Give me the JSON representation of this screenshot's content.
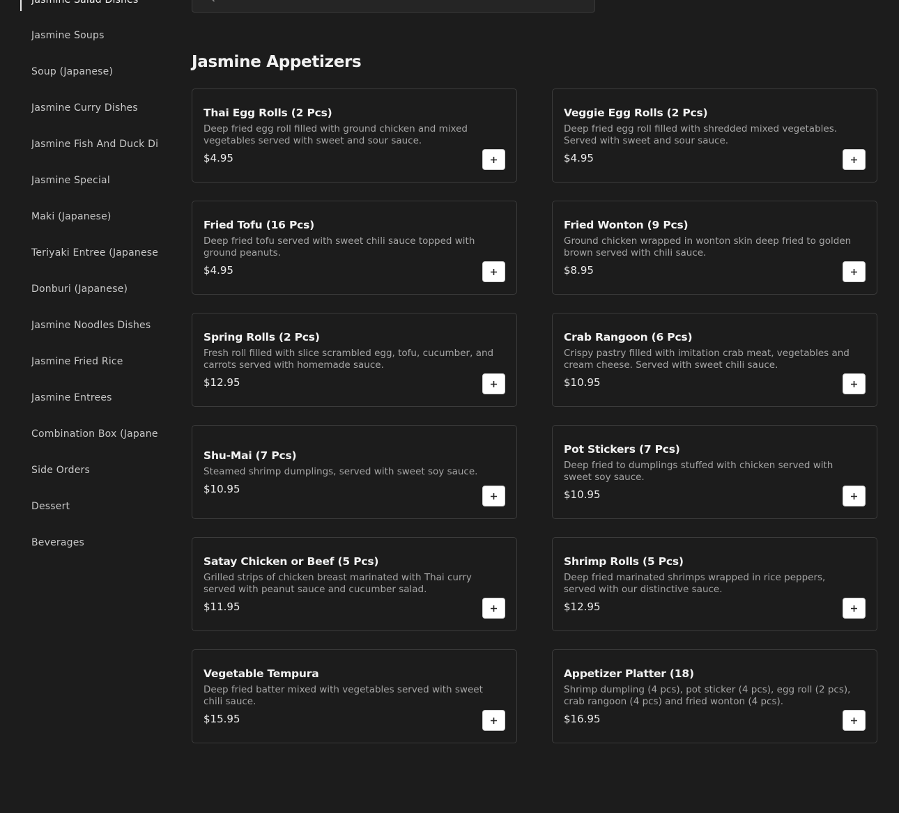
{
  "sidebar": {
    "active_item": "Jasmine Salad Dishes",
    "items": [
      "Jasmine Salad Dishes",
      "Jasmine Soups",
      "Soup (Japanese)",
      "Jasmine Curry Dishes",
      "Jasmine Fish And Duck Dishes",
      "Jasmine Special",
      "Maki (Japanese)",
      "Teriyaki Entree (Japanese)",
      "Donburi (Japanese)",
      "Jasmine Noodles Dishes",
      "Jasmine Fried Rice",
      "Jasmine Entrees",
      "Combination Box (Japanese)",
      "Side Orders",
      "Dessert",
      "Beverages"
    ]
  },
  "search": {
    "icon": "search-icon",
    "placeholder": ""
  },
  "section": {
    "title": "Jasmine Appetizers"
  },
  "items": [
    {
      "name": "Thai Egg Rolls (2 Pcs)",
      "description": "Deep fried egg roll filled with ground chicken and mixed vegetables served with sweet and sour sauce.",
      "price": "$4.95"
    },
    {
      "name": "Veggie Egg Rolls (2 Pcs)",
      "description": "Deep fried egg roll filled with shredded mixed vegetables. Served with sweet and sour sauce.",
      "price": "$4.95"
    },
    {
      "name": "Fried Tofu (16 Pcs)",
      "description": "Deep fried tofu served with sweet chili sauce topped with ground peanuts.",
      "price": "$4.95"
    },
    {
      "name": "Fried Wonton (9 Pcs)",
      "description": "Ground chicken wrapped in wonton skin deep fried to golden brown served with chili sauce.",
      "price": "$8.95"
    },
    {
      "name": "Spring Rolls (2 Pcs)",
      "description": "Fresh roll filled with slice scrambled egg, tofu, cucumber, and carrots served with homemade sauce.",
      "price": "$12.95"
    },
    {
      "name": "Crab Rangoon (6 Pcs)",
      "description": "Crispy pastry filled with imitation crab meat, vegetables and cream cheese. Served with sweet chili sauce.",
      "price": "$10.95"
    },
    {
      "name": "Shu-Mai (7 Pcs)",
      "description": "Steamed shrimp dumplings, served with sweet soy sauce.",
      "price": "$10.95"
    },
    {
      "name": "Pot Stickers (7 Pcs)",
      "description": "Deep fried to dumplings stuffed with chicken served with sweet soy sauce.",
      "price": "$10.95"
    },
    {
      "name": "Satay Chicken or Beef (5 Pcs)",
      "description": "Grilled strips of chicken breast marinated with Thai curry served with peanut sauce and cucumber salad.",
      "price": "$11.95"
    },
    {
      "name": "Shrimp Rolls (5 Pcs)",
      "description": "Deep fried marinated shrimps wrapped in rice peppers, served with our distinctive sauce.",
      "price": "$12.95"
    },
    {
      "name": "Vegetable Tempura",
      "description": "Deep fried batter mixed with vegetables served with sweet chili sauce.",
      "price": "$15.95"
    },
    {
      "name": "Appetizer Platter (18)",
      "description": "Shrimp dumpling (4 pcs), pot sticker (4 pcs), egg roll (2 pcs), crab rangoon (4 pcs) and fried wonton (4 pcs).",
      "price": "$16.95"
    }
  ],
  "add_button": {
    "icon": "plus-icon"
  },
  "colors": {
    "background": "#1c1c1c",
    "card_border": "#3b3b3b",
    "text_primary": "#f2f2f2",
    "text_secondary": "#a5a5a5",
    "button_bg": "#ffffff"
  }
}
